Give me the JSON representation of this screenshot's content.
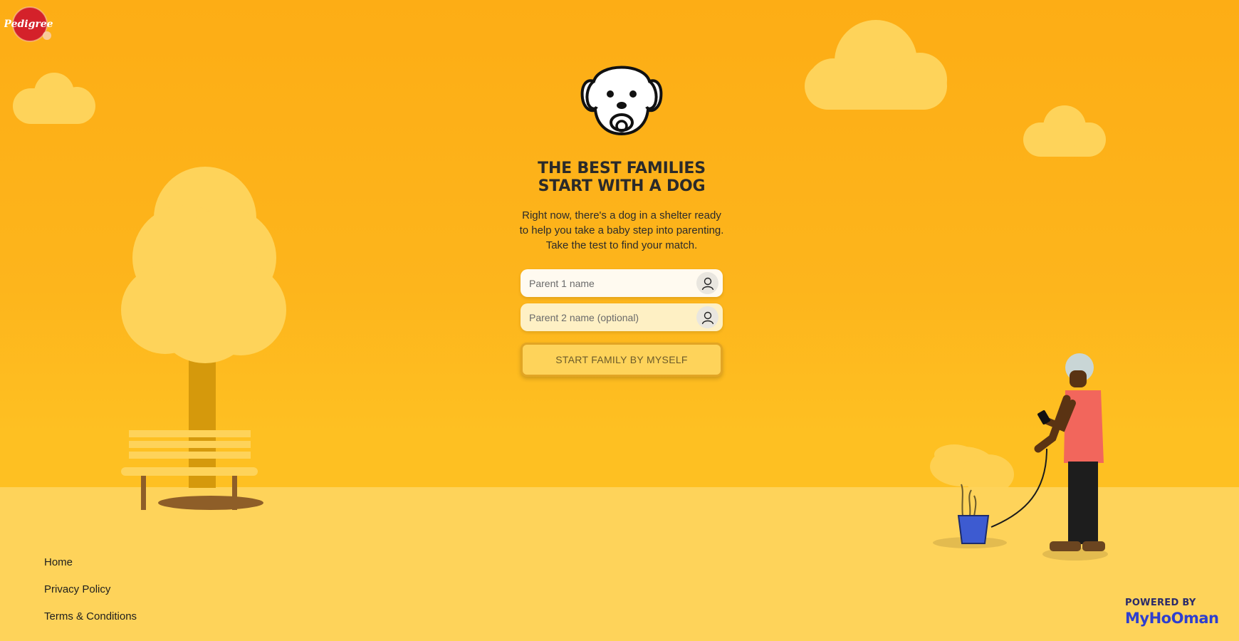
{
  "brand": {
    "logo_text": "Pedigree",
    "colors": {
      "background": "#fdb51c",
      "ground": "#fed35a",
      "accent": "#2e3fcf"
    }
  },
  "hero": {
    "icon": "puppy-with-pacifier-icon",
    "headline": [
      "THE BEST FAMILIES",
      "START WITH A DOG"
    ],
    "intro": [
      "Right now, there's a dog in a shelter ready",
      "to help you take a baby step into parenting.",
      "Take the test to find your match."
    ]
  },
  "form": {
    "parent1": {
      "placeholder": "Parent 1 name",
      "value": "",
      "icon": "user-icon"
    },
    "parent2": {
      "placeholder": "Parent 2 name (optional)",
      "value": "",
      "icon": "user-icon"
    },
    "cta_label": "START FAMILY BY MYSELF"
  },
  "footer": {
    "links": [
      "Home",
      "Privacy Policy",
      "Terms & Conditions"
    ]
  },
  "powered_by": {
    "label": "POWERED BY",
    "brand": "MyHoOman"
  }
}
